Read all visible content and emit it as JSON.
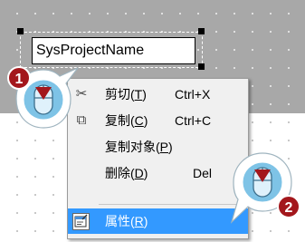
{
  "canvas": {
    "object_text": "SysProjectName"
  },
  "context_menu": {
    "items": [
      {
        "icon": "scissors-icon",
        "glyph": "✂",
        "label": "剪切(",
        "mnemonic": "T",
        "label_end": ")",
        "accel": "Ctrl+X"
      },
      {
        "icon": "copy-icon",
        "glyph": "⧉",
        "label": "复制(",
        "mnemonic": "C",
        "label_end": ")",
        "accel": "Ctrl+C"
      },
      {
        "icon": "",
        "glyph": "",
        "label": "复制对象(",
        "mnemonic": "P",
        "label_end": ")",
        "accel": ""
      },
      {
        "icon": "",
        "glyph": "",
        "label": "删除(",
        "mnemonic": "D",
        "label_end": ")",
        "accel": "Del"
      },
      {
        "icon": "properties-icon",
        "glyph": "",
        "label": "属性(",
        "mnemonic": "R",
        "label_end": ")",
        "accel": ""
      }
    ],
    "highlighted_index": 4
  },
  "callouts": [
    {
      "number": "1",
      "target": "canvas-object"
    },
    {
      "number": "2",
      "target": "properties-menu-item"
    }
  ],
  "colors": {
    "highlight": "#3399ff",
    "callout_badge": "#a3171c",
    "mouse_body": "#7ec3e6",
    "mouse_arrow": "#a3171c"
  }
}
